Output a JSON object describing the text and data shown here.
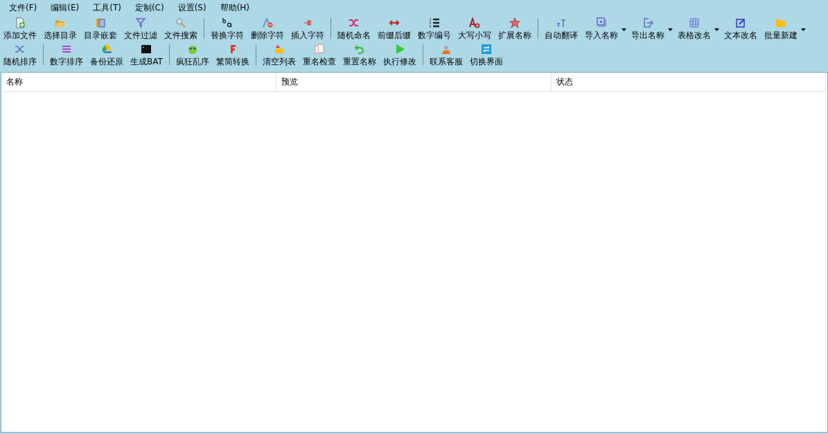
{
  "menu": [
    "文件(F)",
    "编辑(E)",
    "工具(T)",
    "定制(C)",
    "设置(S)",
    "帮助(H)"
  ],
  "toolbar_rows": [
    [
      {
        "kind": "button",
        "label": "添加文件"
      },
      {
        "kind": "button",
        "label": "选择目录"
      },
      {
        "kind": "button",
        "label": "目录嵌套"
      },
      {
        "kind": "button",
        "label": "文件过滤"
      },
      {
        "kind": "button",
        "label": "文件搜索"
      },
      {
        "kind": "separator"
      },
      {
        "kind": "button",
        "label": "替换字符"
      },
      {
        "kind": "button",
        "label": "删除字符"
      },
      {
        "kind": "button",
        "label": "插入字符"
      },
      {
        "kind": "separator"
      },
      {
        "kind": "button",
        "label": "随机命名"
      },
      {
        "kind": "button",
        "label": "前缀后缀"
      },
      {
        "kind": "button",
        "label": "数字编号"
      },
      {
        "kind": "button",
        "label": "大写小写"
      },
      {
        "kind": "button",
        "label": "扩展名称"
      },
      {
        "kind": "separator"
      },
      {
        "kind": "button",
        "label": "自动翻译"
      },
      {
        "kind": "dropdown",
        "label": "导入名称"
      },
      {
        "kind": "dropdown",
        "label": "导出名称"
      },
      {
        "kind": "dropdown",
        "label": "表格改名"
      },
      {
        "kind": "button",
        "label": "文本改名"
      },
      {
        "kind": "dropdown",
        "label": "批量新建"
      }
    ],
    [
      {
        "kind": "button",
        "label": "随机排序"
      },
      {
        "kind": "separator"
      },
      {
        "kind": "button",
        "label": "数字排序"
      },
      {
        "kind": "button",
        "label": "备份还原"
      },
      {
        "kind": "button",
        "label": "生成BAT"
      },
      {
        "kind": "separator"
      },
      {
        "kind": "button",
        "label": "疯狂乱序"
      },
      {
        "kind": "button",
        "label": "繁简转换"
      },
      {
        "kind": "separator"
      },
      {
        "kind": "button",
        "label": "清空列表"
      },
      {
        "kind": "button",
        "label": "重名检查"
      },
      {
        "kind": "button",
        "label": "重置名称"
      },
      {
        "kind": "button",
        "label": "执行修改"
      },
      {
        "kind": "separator"
      },
      {
        "kind": "button",
        "label": "联系客服"
      },
      {
        "kind": "button",
        "label": "切换界面"
      }
    ]
  ],
  "table": {
    "columns": [
      "名称",
      "预览",
      "状态"
    ]
  }
}
